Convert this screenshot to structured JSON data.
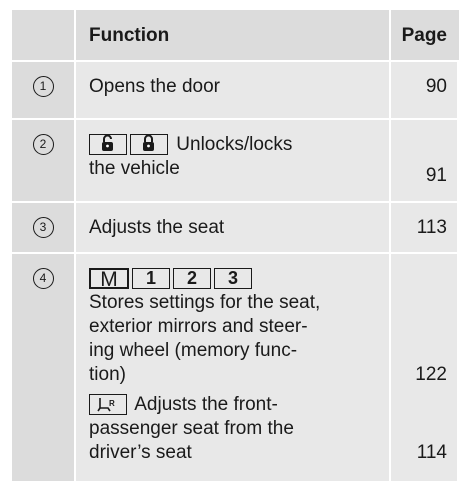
{
  "header": {
    "function": "Function",
    "page": "Page"
  },
  "rows": [
    {
      "num": "1",
      "text": "Opens the door",
      "page": "90"
    },
    {
      "num": "2",
      "text_line1": "Unlocks/locks",
      "text_line2": "the vehicle",
      "page": "91",
      "icons": [
        "unlock-key-icon",
        "lock-key-icon"
      ]
    },
    {
      "num": "3",
      "text": "Adjusts the seat",
      "page": "113"
    },
    {
      "num": "4",
      "keys": [
        "M",
        "1",
        "2",
        "3"
      ],
      "text_lines": [
        "Stores settings for the seat,",
        "exterior mirrors and steer-",
        "ing wheel (memory func-",
        "tion)"
      ],
      "page": "122",
      "sub": {
        "icon": "front-passenger-seat-key-icon",
        "lines": [
          "Adjusts the front-",
          "passenger seat from the",
          "driver’s seat"
        ],
        "page": "114"
      }
    }
  ]
}
